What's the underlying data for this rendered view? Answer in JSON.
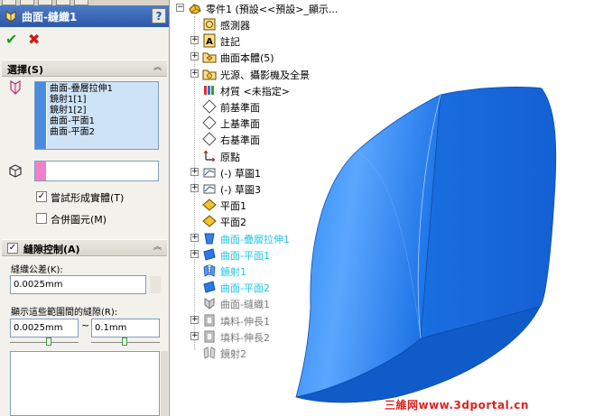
{
  "property_manager": {
    "title": "曲面-縫織1",
    "help_label": "?",
    "ok_label": "✔",
    "cancel_label": "✖",
    "selections": {
      "header": "選擇(S)",
      "items": [
        "曲面-疊層拉伸1",
        "鏡射1[1]",
        "鏡射1[2]",
        "曲面-平面1",
        "曲面-平面2"
      ],
      "try_form_solid": "嘗試形成實體(T)",
      "try_form_solid_checked": true,
      "merge_entities": "合併圖元(M)",
      "merge_entities_checked": false
    },
    "gap_control": {
      "header": "縫隙控制(A)",
      "checked": true,
      "tolerance_label": "縫織公差(K):",
      "tolerance_value": "0.0025mm",
      "range_label": "顯示這些範圍間的縫隙(R):",
      "range_min": "0.0025mm",
      "range_max": "0.1mm",
      "tilde": "~"
    }
  },
  "feature_tree": {
    "root": "零件1 (預設<<預設>_顯示...",
    "nodes": [
      {
        "label": "感測器",
        "icon": "sensor-icon",
        "expander": false,
        "state": "normal"
      },
      {
        "label": "註記",
        "icon": "annotation-icon",
        "expander": true,
        "state": "normal"
      },
      {
        "label": "曲面本體(5)",
        "icon": "surface-bodies-folder-icon",
        "expander": true,
        "state": "normal"
      },
      {
        "label": "光源、攝影機及全景",
        "icon": "lights-cameras-scene-icon",
        "expander": true,
        "state": "normal"
      },
      {
        "label": "材質 <未指定>",
        "icon": "material-icon",
        "expander": false,
        "state": "normal"
      },
      {
        "label": "前基準面",
        "icon": "plane-icon",
        "expander": false,
        "state": "normal"
      },
      {
        "label": "上基準面",
        "icon": "plane-icon",
        "expander": false,
        "state": "normal"
      },
      {
        "label": "右基準面",
        "icon": "plane-icon",
        "expander": false,
        "state": "normal"
      },
      {
        "label": "原點",
        "icon": "origin-icon",
        "expander": false,
        "state": "normal"
      },
      {
        "label": "(-) 草圖1",
        "icon": "sketch-icon",
        "expander": true,
        "state": "normal"
      },
      {
        "label": "(-) 草圖3",
        "icon": "sketch-icon",
        "expander": true,
        "state": "normal"
      },
      {
        "label": "平面1",
        "icon": "plane-feature-icon",
        "expander": false,
        "state": "normal"
      },
      {
        "label": "平面2",
        "icon": "plane-feature-icon",
        "expander": false,
        "state": "normal"
      },
      {
        "label": "曲面-疊層拉伸1",
        "icon": "loft-surface-icon",
        "expander": true,
        "state": "highlight"
      },
      {
        "label": "曲面-平面1",
        "icon": "planar-surface-icon",
        "expander": true,
        "state": "highlight"
      },
      {
        "label": "鏡射1",
        "icon": "mirror-icon",
        "expander": false,
        "state": "highlight"
      },
      {
        "label": "曲面-平面2",
        "icon": "planar-surface-icon",
        "expander": false,
        "state": "highlight"
      },
      {
        "label": "曲面-縫織1",
        "icon": "knit-surface-icon",
        "expander": false,
        "state": "dim"
      },
      {
        "label": "填料-伸長1",
        "icon": "extrude-icon",
        "expander": true,
        "state": "dim"
      },
      {
        "label": "填料-伸長2",
        "icon": "extrude-icon",
        "expander": true,
        "state": "dim"
      },
      {
        "label": "鏡射2",
        "icon": "mirror-feature-icon",
        "expander": false,
        "state": "dim"
      }
    ]
  },
  "watermark": "三維网www.3dportal.cn",
  "colors": {
    "highlight_text": "#22c4e8",
    "model_blue": "#1f78e8",
    "header_blue": "#2c58a8"
  }
}
